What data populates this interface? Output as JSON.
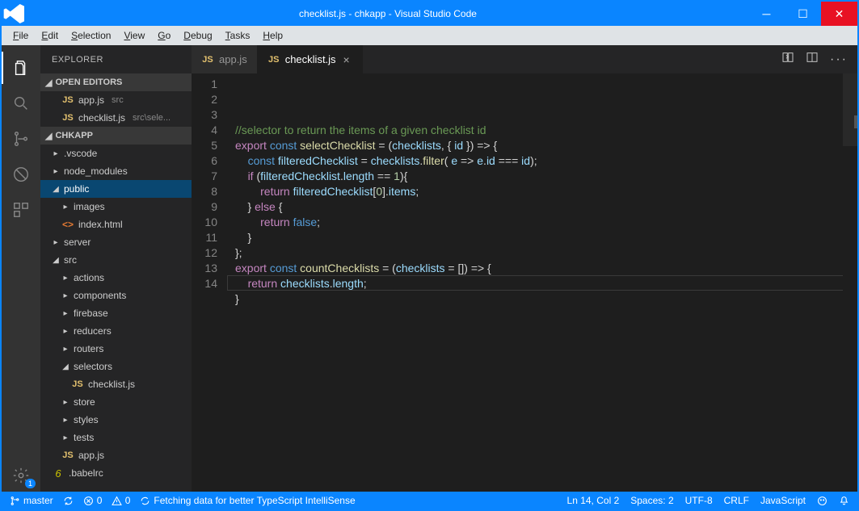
{
  "titlebar": {
    "title": "checklist.js - chkapp - Visual Studio Code"
  },
  "menubar": [
    "File",
    "Edit",
    "Selection",
    "View",
    "Go",
    "Debug",
    "Tasks",
    "Help"
  ],
  "activity": {
    "settings_badge": "1"
  },
  "sidebar": {
    "title": "EXPLORER",
    "sections": {
      "open_editors": {
        "label": "OPEN EDITORS",
        "items": [
          {
            "icon": "JS",
            "name": "app.js",
            "hint": "src"
          },
          {
            "icon": "JS",
            "name": "checklist.js",
            "hint": "src\\sele..."
          }
        ]
      },
      "project": {
        "label": "CHKAPP",
        "tree": [
          {
            "lvl": 1,
            "type": "folder",
            "open": false,
            "name": ".vscode"
          },
          {
            "lvl": 1,
            "type": "folder",
            "open": false,
            "name": "node_modules"
          },
          {
            "lvl": 1,
            "type": "folder",
            "open": true,
            "name": "public",
            "selected": true
          },
          {
            "lvl": 2,
            "type": "folder",
            "open": false,
            "name": "images"
          },
          {
            "lvl": 2,
            "type": "file",
            "icon": "html",
            "name": "index.html"
          },
          {
            "lvl": 1,
            "type": "folder",
            "open": false,
            "name": "server"
          },
          {
            "lvl": 1,
            "type": "folder",
            "open": true,
            "name": "src"
          },
          {
            "lvl": 2,
            "type": "folder",
            "open": false,
            "name": "actions"
          },
          {
            "lvl": 2,
            "type": "folder",
            "open": false,
            "name": "components"
          },
          {
            "lvl": 2,
            "type": "folder",
            "open": false,
            "name": "firebase"
          },
          {
            "lvl": 2,
            "type": "folder",
            "open": false,
            "name": "reducers"
          },
          {
            "lvl": 2,
            "type": "folder",
            "open": false,
            "name": "routers"
          },
          {
            "lvl": 2,
            "type": "folder",
            "open": true,
            "name": "selectors"
          },
          {
            "lvl": 3,
            "type": "file",
            "icon": "js",
            "name": "checklist.js"
          },
          {
            "lvl": 2,
            "type": "folder",
            "open": false,
            "name": "store"
          },
          {
            "lvl": 2,
            "type": "folder",
            "open": false,
            "name": "styles"
          },
          {
            "lvl": 2,
            "type": "folder",
            "open": false,
            "name": "tests"
          },
          {
            "lvl": 2,
            "type": "file",
            "icon": "js",
            "name": "app.js"
          },
          {
            "lvl": 1,
            "type": "file",
            "icon": "babel",
            "name": ".babelrc"
          }
        ]
      }
    }
  },
  "tabs": [
    {
      "icon": "JS",
      "label": "app.js",
      "active": false
    },
    {
      "icon": "JS",
      "label": "checklist.js",
      "active": true
    }
  ],
  "code": {
    "lines": [
      "//selector to return the items of a given checklist id",
      "",
      "export const selectChecklist = (checklists, { id }) => {",
      "    const filteredChecklist = checklists.filter( e => e.id === id);",
      "    if (filteredChecklist.length == 1){",
      "        return filteredChecklist[0].items;",
      "    } else {",
      "        return false;",
      "    }",
      "};",
      "",
      "export const countChecklists = (checklists = []) => {",
      "    return checklists.length;",
      "}"
    ],
    "current_line_index": 13
  },
  "statusbar": {
    "branch": "master",
    "errors": "0",
    "warnings": "0",
    "sync_msg": "Fetching data for better TypeScript IntelliSense",
    "ln_col": "Ln 14, Col 2",
    "spaces": "Spaces: 2",
    "encoding": "UTF-8",
    "eol": "CRLF",
    "language": "JavaScript"
  }
}
